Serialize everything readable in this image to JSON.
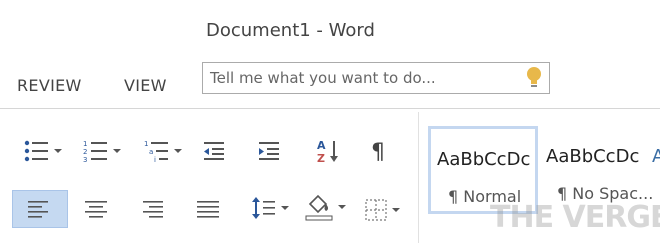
{
  "window": {
    "title": "Document1 - Word"
  },
  "tabs": [
    {
      "label": "REVIEW"
    },
    {
      "label": "VIEW"
    }
  ],
  "tell_me": {
    "placeholder": "Tell me what you want to do..."
  },
  "paragraph_buttons": {
    "icons": [
      "bullets-icon",
      "numbering-icon",
      "multilevel-list-icon",
      "decrease-indent-icon",
      "increase-indent-icon",
      "sort-icon",
      "show-formatting-icon",
      "align-left-icon",
      "align-center-icon",
      "align-right-icon",
      "justify-icon",
      "line-spacing-icon",
      "shading-icon",
      "borders-icon"
    ],
    "active": "align-left"
  },
  "styles": [
    {
      "sample": "AaBbCcDc",
      "name": "¶ Normal",
      "selected": true
    },
    {
      "sample": "AaBbCcDc",
      "name": "¶ No Spac..."
    }
  ],
  "watermark": "THE VERGE",
  "colors": {
    "accent_blue": "#2b579a",
    "selection": "#c5d9f1"
  }
}
